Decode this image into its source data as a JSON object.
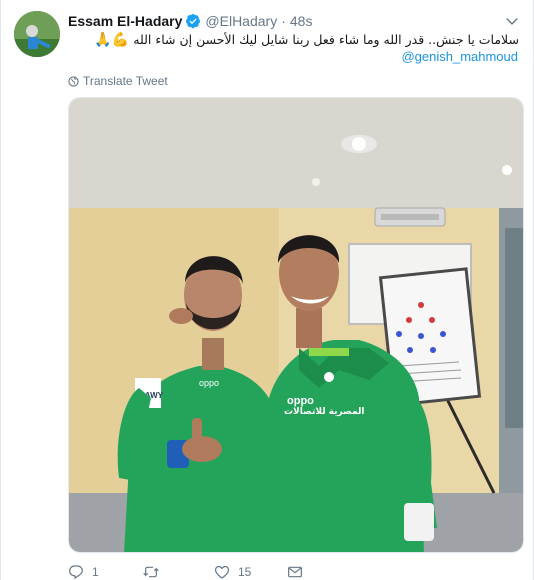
{
  "tweet": {
    "author_name": "Essam El-Hadary",
    "handle": "@ElHadary",
    "separator": "·",
    "time": "48s",
    "text": "سلامات يا جنش.. قدر الله وما شاء فعل ربنا شايل ليك الأحسن إن شاء الله",
    "emoji_1": "💪",
    "emoji_2": "🙏",
    "mention": "@genish_mahmoud",
    "translate_label": "Translate Tweet",
    "reply_count": "1",
    "retweet_count": "",
    "like_count": "15"
  },
  "photo": {
    "jersey_sponsor": "oppo",
    "jersey_text": "المصرية للاتصالات",
    "number_badge": "RAWY"
  },
  "colors": {
    "link": "#1b95e0",
    "secondary": "#657786",
    "verified": "#1da1f2",
    "jersey": "#23a45a"
  },
  "icons": {
    "verified": "verified-badge-icon",
    "caret": "chevron-down-icon",
    "translate": "globe-icon",
    "reply": "reply-icon",
    "retweet": "retweet-icon",
    "like": "heart-icon",
    "dm": "envelope-icon"
  }
}
